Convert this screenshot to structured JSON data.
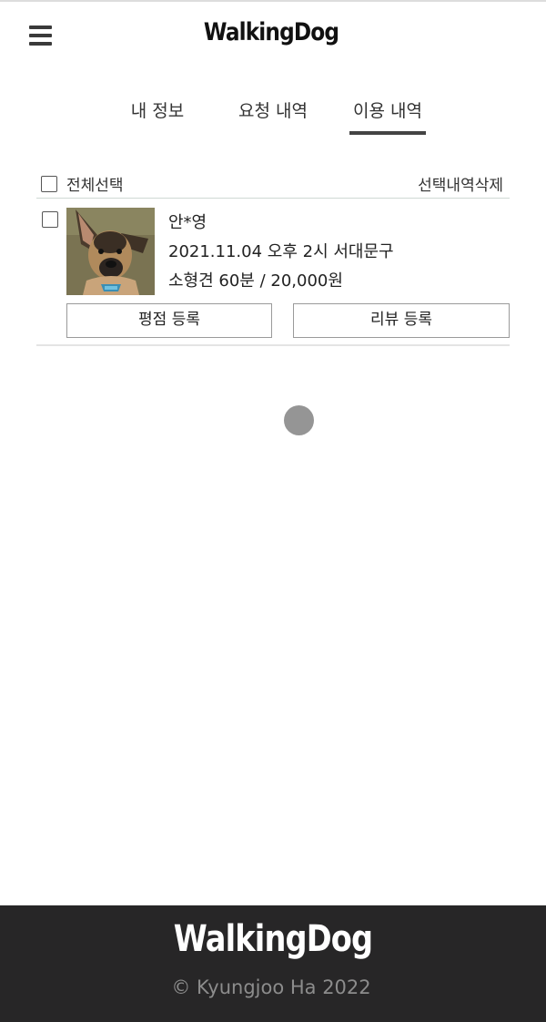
{
  "header": {
    "logo": "WalkingDog",
    "menu_icon": "hamburger-menu-icon"
  },
  "tabs": [
    {
      "label": "내 정보",
      "active": false
    },
    {
      "label": "요청 내역",
      "active": false
    },
    {
      "label": "이용 내역",
      "active": true
    }
  ],
  "list": {
    "select_all_label": "전체선택",
    "delete_selected_label": "선택내역삭제",
    "items": [
      {
        "name": "안*영",
        "schedule": "2021.11.04 오후 2시 서대문구",
        "service": "소형견 60분 / 20,000원",
        "rating_button": "평점 등록",
        "review_button": "리뷰 등록",
        "checked": false
      }
    ]
  },
  "footer": {
    "logo": "WalkingDog",
    "copyright": "© Kyungjoo Ha 2022"
  },
  "colors": {
    "footer_bg": "#272627",
    "tab_underline": "#444444",
    "spinner": "#959595"
  }
}
